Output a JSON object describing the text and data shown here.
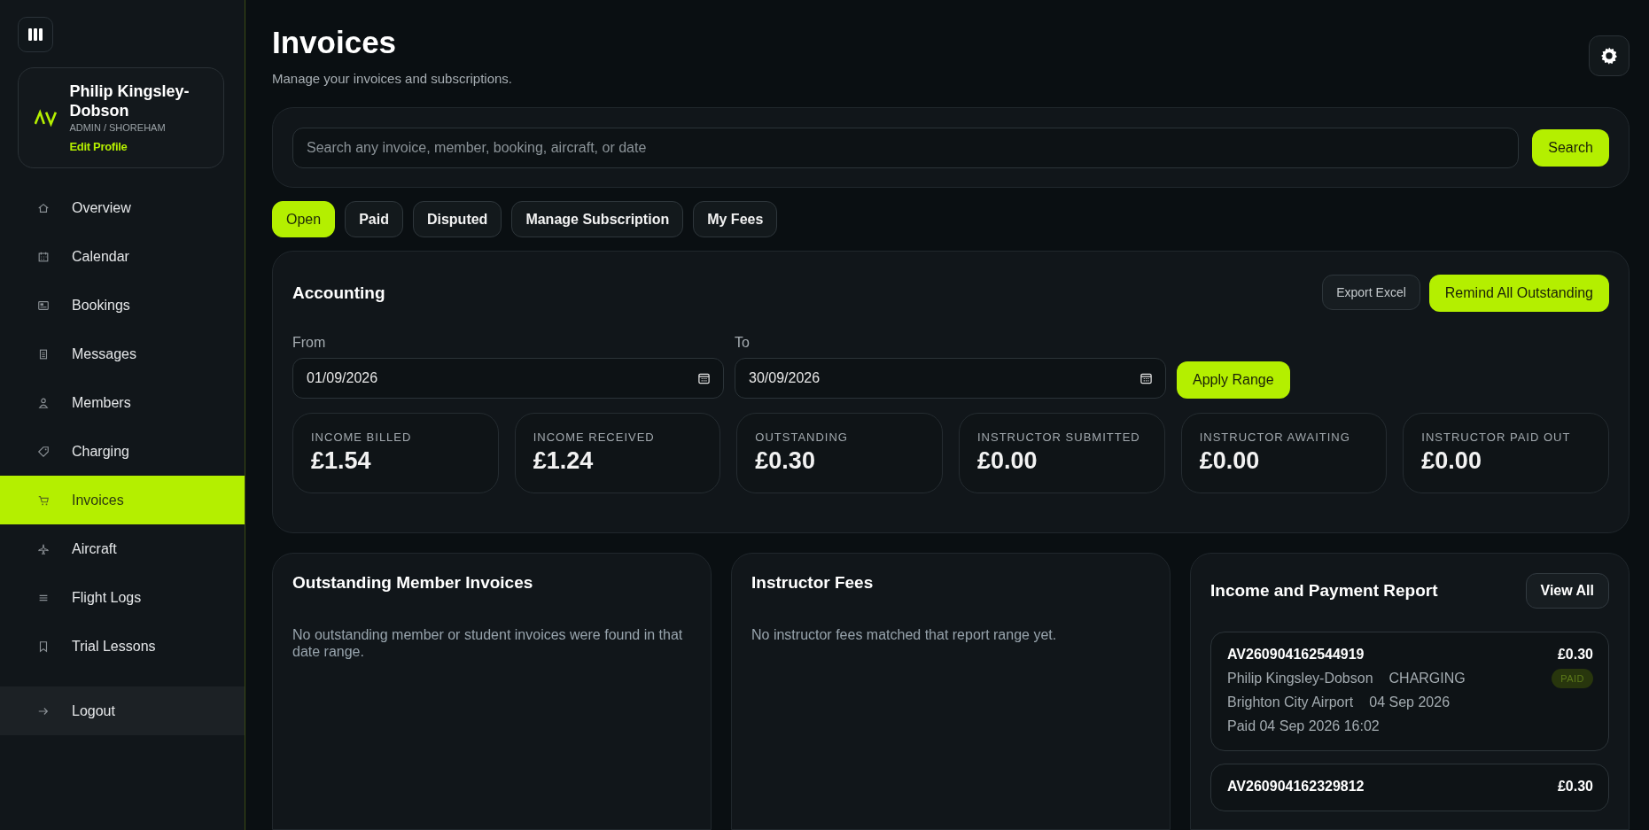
{
  "sidebar": {
    "profile": {
      "name": "Philip Kingsley-Dobson",
      "role": "ADMIN / SHOREHAM",
      "edit_link": "Edit Profile"
    },
    "items": [
      {
        "label": "Overview",
        "selected": false
      },
      {
        "label": "Calendar",
        "selected": false
      },
      {
        "label": "Bookings",
        "selected": false
      },
      {
        "label": "Messages",
        "selected": false
      },
      {
        "label": "Members",
        "selected": false
      },
      {
        "label": "Charging",
        "selected": false
      },
      {
        "label": "Invoices",
        "selected": true
      },
      {
        "label": "Aircraft",
        "selected": false
      },
      {
        "label": "Flight Logs",
        "selected": false
      },
      {
        "label": "Trial Lessons",
        "selected": false
      }
    ],
    "logout": "Logout"
  },
  "header": {
    "title": "Invoices",
    "subtitle": "Manage your invoices and subscriptions."
  },
  "search": {
    "placeholder": "Search any invoice, member, booking, aircraft, or date",
    "button": "Search"
  },
  "tabs": [
    {
      "label": "Open",
      "selected": true
    },
    {
      "label": "Paid",
      "selected": false
    },
    {
      "label": "Disputed",
      "selected": false
    },
    {
      "label": "Manage Subscription",
      "selected": false
    },
    {
      "label": "My Fees",
      "selected": false
    }
  ],
  "accounting": {
    "title": "Accounting",
    "export_button": "Export Excel",
    "remind_button": "Remind All Outstanding",
    "from": {
      "label": "From",
      "value": "01/09/2026"
    },
    "to": {
      "label": "To",
      "value": "30/09/2026"
    },
    "apply_button": "Apply Range",
    "stats": [
      {
        "label": "INCOME BILLED",
        "value": "£1.54"
      },
      {
        "label": "INCOME RECEIVED",
        "value": "£1.24"
      },
      {
        "label": "OUTSTANDING",
        "value": "£0.30"
      },
      {
        "label": "INSTRUCTOR SUBMITTED",
        "value": "£0.00"
      },
      {
        "label": "INSTRUCTOR AWAITING",
        "value": "£0.00"
      },
      {
        "label": "INSTRUCTOR PAID OUT",
        "value": "£0.00"
      }
    ]
  },
  "outstanding": {
    "title": "Outstanding Member Invoices",
    "empty_text": "No outstanding member or student invoices were found in that date range."
  },
  "instructor_fees": {
    "title": "Instructor Fees",
    "empty_text": "No instructor fees matched that report range yet."
  },
  "report": {
    "title": "Income and Payment Report",
    "view_all": "View All",
    "entries": [
      {
        "id": "AV260904162544919",
        "amount": "£0.30",
        "member": "Philip Kingsley-Dobson",
        "type": "CHARGING",
        "location": "Brighton City Airport",
        "date": "04 Sep 2026",
        "paid_at": "Paid 04 Sep 2026 16:02",
        "status": "PAID"
      },
      {
        "id": "AV260904162329812",
        "amount": "£0.30"
      }
    ]
  }
}
